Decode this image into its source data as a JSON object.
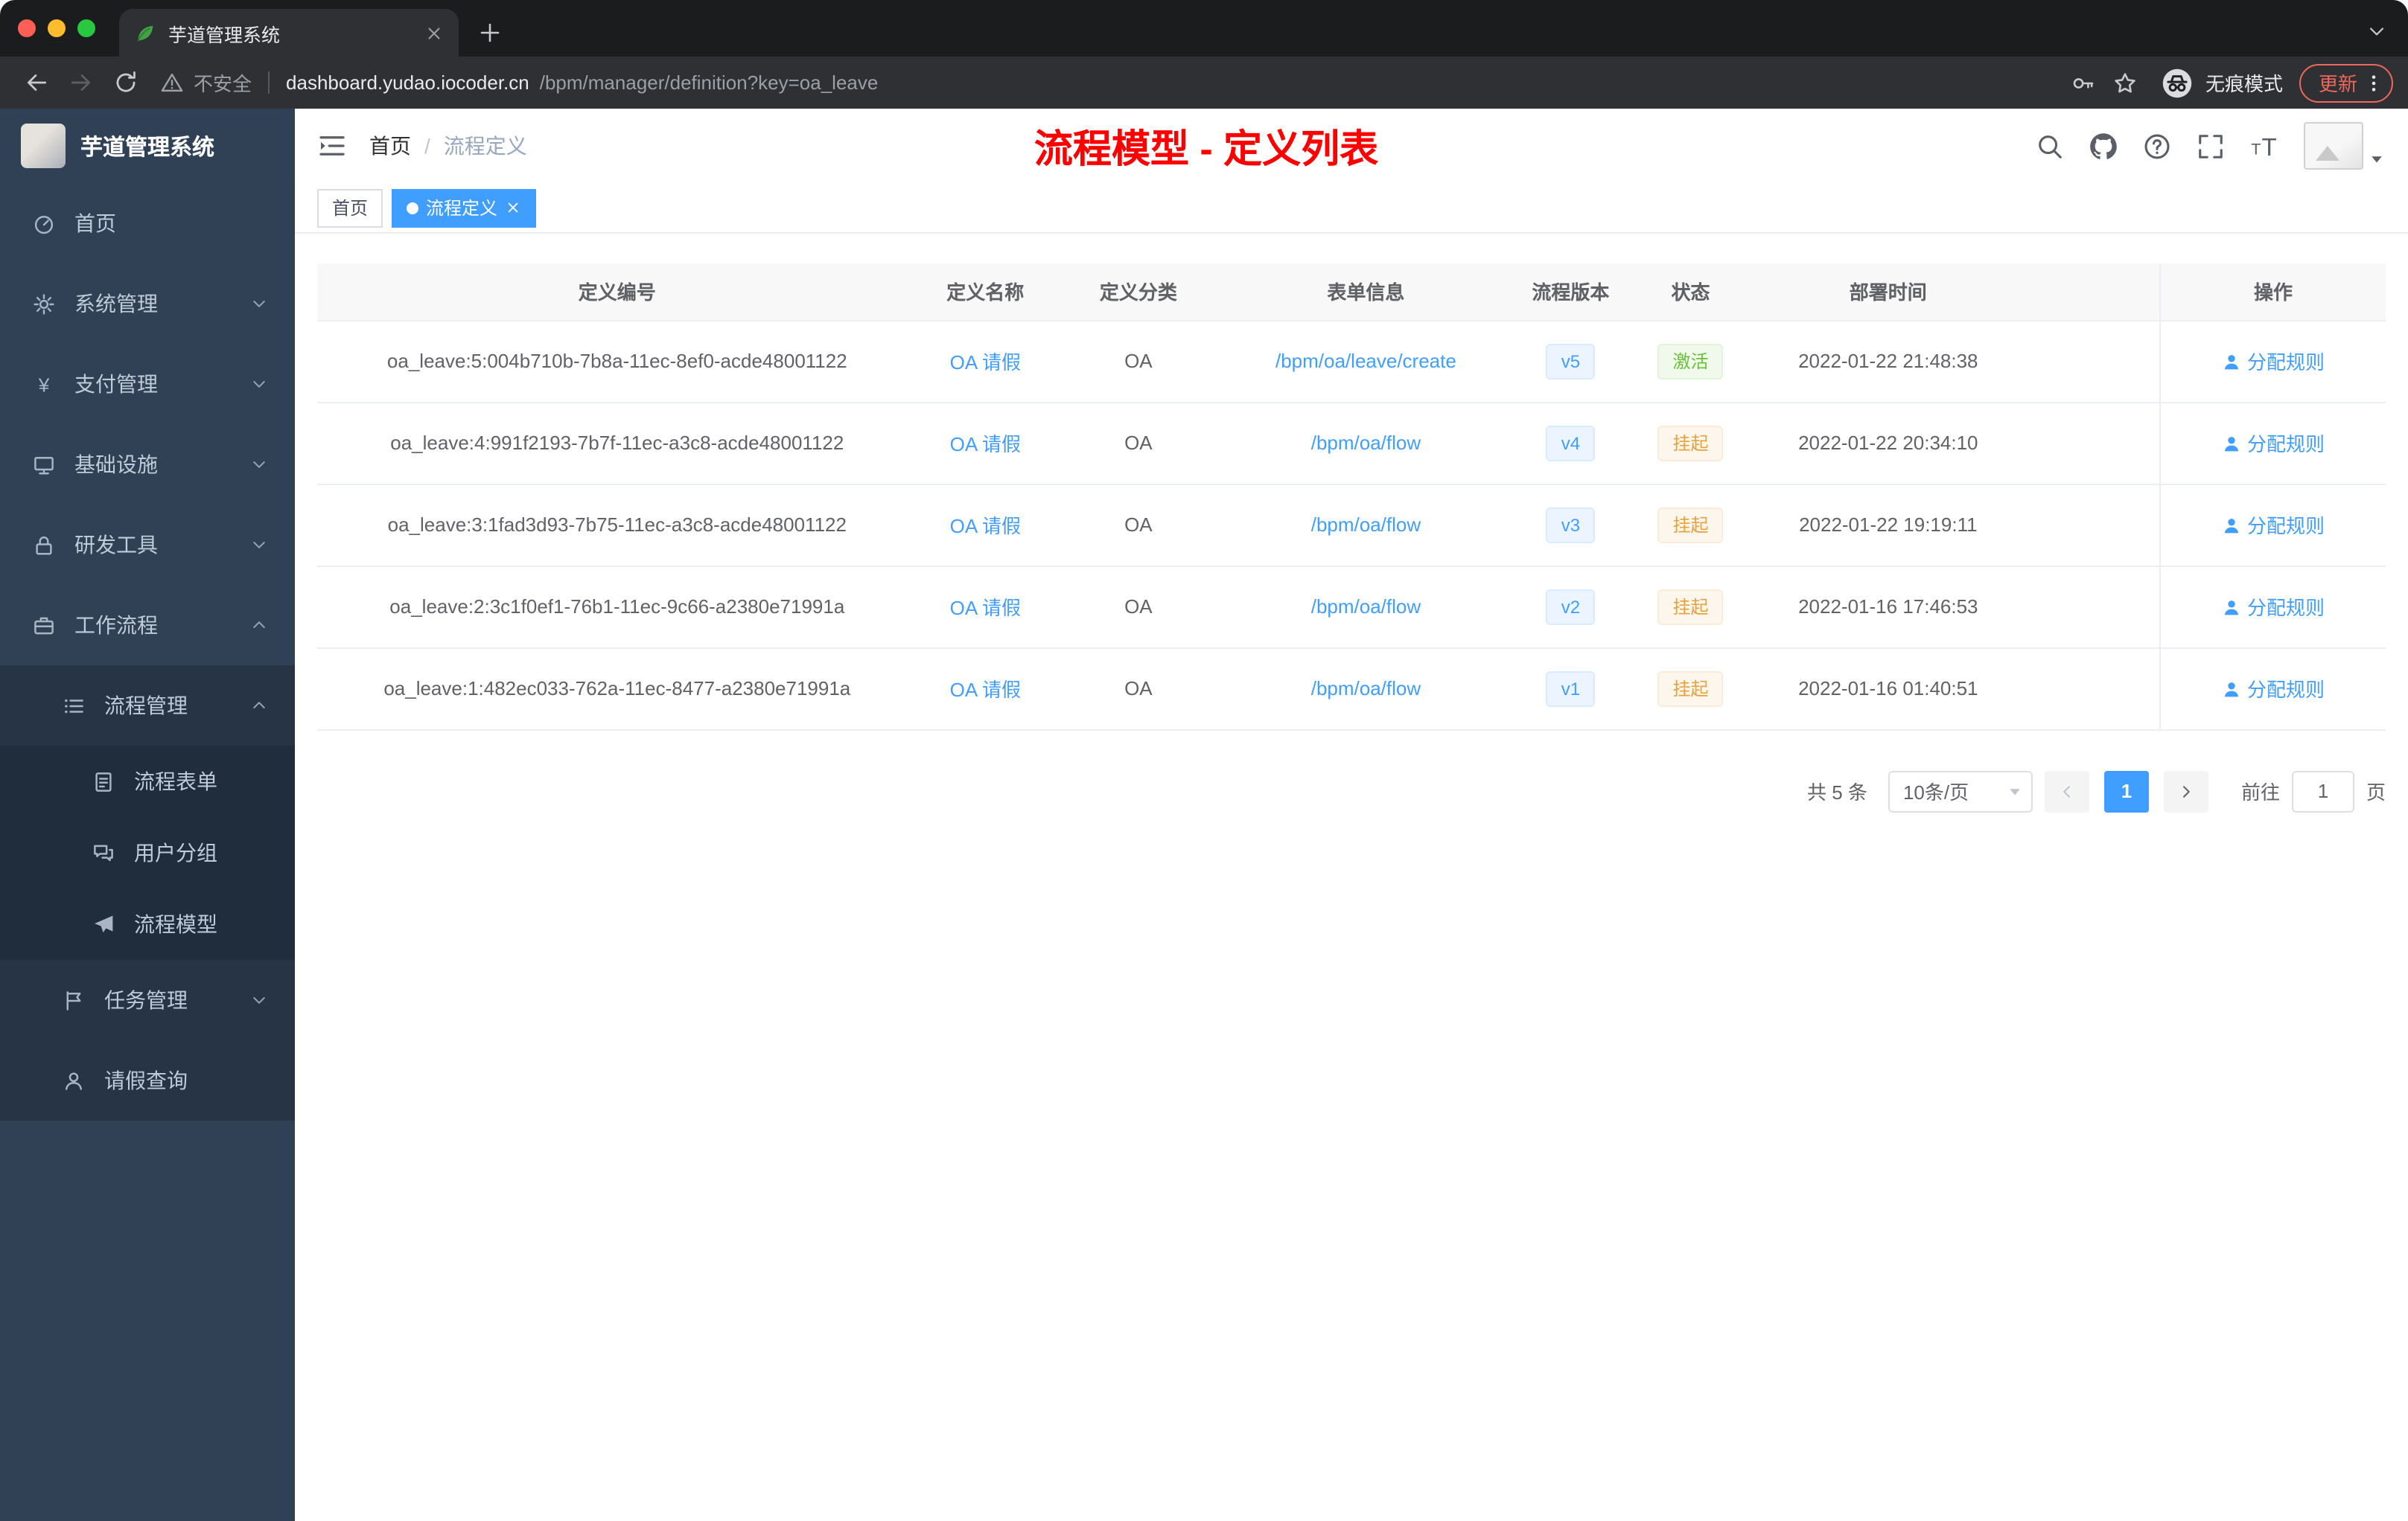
{
  "browser": {
    "tab_title": "芋道管理系统",
    "security_label": "不安全",
    "url_host": "dashboard.yudao.iocoder.cn",
    "url_path": "/bpm/manager/definition?key=oa_leave",
    "incognito_label": "无痕模式",
    "update_label": "更新"
  },
  "sidebar": {
    "logo_title": "芋道管理系统",
    "items": [
      {
        "key": "home",
        "label": "首页",
        "icon": "dashboard",
        "level": 1,
        "expandable": false,
        "expanded": false
      },
      {
        "key": "system-management",
        "label": "系统管理",
        "icon": "gear",
        "level": 1,
        "expandable": true,
        "expanded": false
      },
      {
        "key": "payment-management",
        "label": "支付管理",
        "icon": "yen",
        "level": 1,
        "expandable": true,
        "expanded": false
      },
      {
        "key": "infrastructure",
        "label": "基础设施",
        "icon": "monitor",
        "level": 1,
        "expandable": true,
        "expanded": false
      },
      {
        "key": "dev-tools",
        "label": "研发工具",
        "icon": "lock",
        "level": 1,
        "expandable": true,
        "expanded": false
      },
      {
        "key": "workflow",
        "label": "工作流程",
        "icon": "briefcase",
        "level": 1,
        "expandable": true,
        "expanded": true
      },
      {
        "key": "process-management",
        "label": "流程管理",
        "icon": "list",
        "level": 2,
        "expandable": true,
        "expanded": true
      },
      {
        "key": "process-form",
        "label": "流程表单",
        "icon": "doc",
        "level": 3,
        "expandable": false,
        "expanded": false
      },
      {
        "key": "user-group",
        "label": "用户分组",
        "icon": "chat",
        "level": 3,
        "expandable": false,
        "expanded": false
      },
      {
        "key": "process-model",
        "label": "流程模型",
        "icon": "plane",
        "level": 3,
        "expandable": false,
        "expanded": false
      },
      {
        "key": "task-management",
        "label": "任务管理",
        "icon": "flag",
        "level": 2,
        "expandable": true,
        "expanded": false
      },
      {
        "key": "leave-query",
        "label": "请假查询",
        "icon": "user",
        "level": 2,
        "expandable": false,
        "expanded": false
      }
    ]
  },
  "header": {
    "breadcrumb_home": "首页",
    "breadcrumb_current": "流程定义",
    "page_title": "流程模型 - 定义列表"
  },
  "tags": [
    {
      "label": "首页",
      "active": false
    },
    {
      "label": "流程定义",
      "active": true
    }
  ],
  "table": {
    "columns": [
      "定义编号",
      "定义名称",
      "定义分类",
      "表单信息",
      "流程版本",
      "状态",
      "部署时间",
      "操作"
    ],
    "rows": [
      {
        "id": "oa_leave:5:004b710b-7b8a-11ec-8ef0-acde48001122",
        "name": "OA 请假",
        "category": "OA",
        "form": "/bpm/oa/leave/create",
        "version": "v5",
        "status": "激活",
        "status_type": "success",
        "deploy_time": "2022-01-22 21:48:38",
        "action": "分配规则"
      },
      {
        "id": "oa_leave:4:991f2193-7b7f-11ec-a3c8-acde48001122",
        "name": "OA 请假",
        "category": "OA",
        "form": "/bpm/oa/flow",
        "version": "v4",
        "status": "挂起",
        "status_type": "warning",
        "deploy_time": "2022-01-22 20:34:10",
        "action": "分配规则"
      },
      {
        "id": "oa_leave:3:1fad3d93-7b75-11ec-a3c8-acde48001122",
        "name": "OA 请假",
        "category": "OA",
        "form": "/bpm/oa/flow",
        "version": "v3",
        "status": "挂起",
        "status_type": "warning",
        "deploy_time": "2022-01-22 19:19:11",
        "action": "分配规则"
      },
      {
        "id": "oa_leave:2:3c1f0ef1-76b1-11ec-9c66-a2380e71991a",
        "name": "OA 请假",
        "category": "OA",
        "form": "/bpm/oa/flow",
        "version": "v2",
        "status": "挂起",
        "status_type": "warning",
        "deploy_time": "2022-01-16 17:46:53",
        "action": "分配规则"
      },
      {
        "id": "oa_leave:1:482ec033-762a-11ec-8477-a2380e71991a",
        "name": "OA 请假",
        "category": "OA",
        "form": "/bpm/oa/flow",
        "version": "v1",
        "status": "挂起",
        "status_type": "warning",
        "deploy_time": "2022-01-16 01:40:51",
        "action": "分配规则"
      }
    ]
  },
  "pagination": {
    "total_label": "共 5 条",
    "page_size": "10条/页",
    "current_page": "1",
    "goto_label": "前往",
    "goto_value": "1",
    "page_label": "页"
  },
  "colors": {
    "accent": "#409eff",
    "page_title": "#fe0000",
    "status_active": "#67c23a",
    "status_suspended": "#e6a23c",
    "sidebar_bg": "#304156"
  }
}
